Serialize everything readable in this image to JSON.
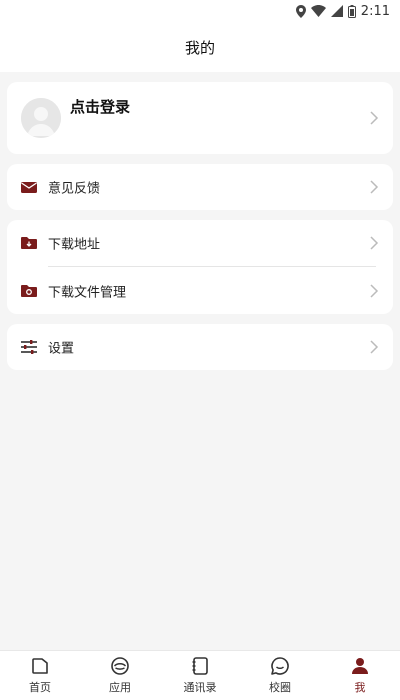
{
  "status_bar": {
    "time": "2:11",
    "icons": [
      "location-icon",
      "wifi-icon",
      "signal-icon",
      "battery-icon"
    ]
  },
  "header": {
    "title": "我的"
  },
  "profile": {
    "login_text": "点击登录",
    "avatar_icon": "avatar-placeholder-icon"
  },
  "menu_groups": [
    {
      "items": [
        {
          "label": "意见反馈",
          "icon": "mail-icon"
        }
      ]
    },
    {
      "items": [
        {
          "label": "下载地址",
          "icon": "folder-download-icon"
        },
        {
          "label": "下载文件管理",
          "icon": "folder-camera-icon"
        }
      ]
    },
    {
      "items": [
        {
          "label": "设置",
          "icon": "sliders-icon"
        }
      ]
    }
  ],
  "tabbar": {
    "tabs": [
      {
        "label": "首页",
        "icon": "home-icon"
      },
      {
        "label": "应用",
        "icon": "apps-icon"
      },
      {
        "label": "通讯录",
        "icon": "contacts-icon"
      },
      {
        "label": "校圈",
        "icon": "chat-bubble-icon"
      },
      {
        "label": "我",
        "icon": "person-icon"
      }
    ],
    "active": "我"
  },
  "colors": {
    "accent": "#7a1c1c",
    "background": "#f5f5f5",
    "card": "#ffffff",
    "chevron": "#bbbbbb"
  }
}
